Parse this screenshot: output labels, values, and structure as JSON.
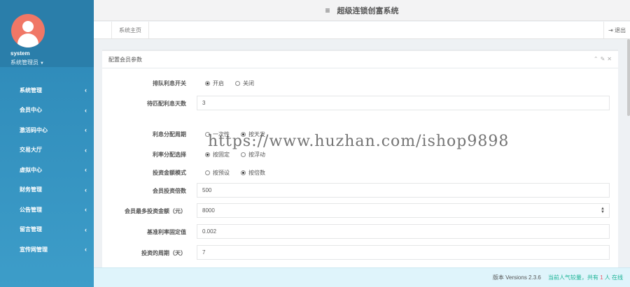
{
  "app": {
    "title": "超级连锁创富系统"
  },
  "user": {
    "name": "system",
    "role": "系统管理员"
  },
  "sidebar": {
    "items": [
      {
        "label": "系统管理"
      },
      {
        "label": "会员中心"
      },
      {
        "label": "激活码中心"
      },
      {
        "label": "交易大厅"
      },
      {
        "label": "虚拟中心"
      },
      {
        "label": "财务管理"
      },
      {
        "label": "公告管理"
      },
      {
        "label": "留言管理"
      },
      {
        "label": "宣传网管理"
      }
    ]
  },
  "tabs": {
    "home": "系统主页",
    "logout": "退出"
  },
  "panel": {
    "title": "配置会员参数",
    "queue": {
      "label": "排队利息开关",
      "options": [
        "开启",
        "关闭"
      ],
      "selected": "开启"
    },
    "wait_days": {
      "label": "待匹配利息天数",
      "value": "3"
    },
    "interest_cycle": {
      "label": "利息分配周期",
      "options": [
        "一次性",
        "按天发"
      ],
      "selected": "按天发"
    },
    "interest_mode": {
      "label": "利率分配选择",
      "options": [
        "按固定",
        "按浮动"
      ],
      "selected": "按固定"
    },
    "invest_mode": {
      "label": "投资金额模式",
      "options": [
        "按预设",
        "按倍数"
      ],
      "selected": "按倍数"
    },
    "multiple": {
      "label": "会员投资倍数",
      "value": "500"
    },
    "max_amount": {
      "label": "会员最多投资金额（元）",
      "value": "8000"
    },
    "base_rate": {
      "label": "基准利率固定值",
      "value": "0.002"
    },
    "cycle_days": {
      "label": "投资的周期（天）",
      "value": "7"
    }
  },
  "footer": {
    "version": "版本 Versions 2.3.6",
    "online_prefix": "当前人气较量，共有",
    "online_count": "1",
    "online_suffix": "人 在线"
  },
  "watermark": "https://www.huzhan.com/ishop9898"
}
